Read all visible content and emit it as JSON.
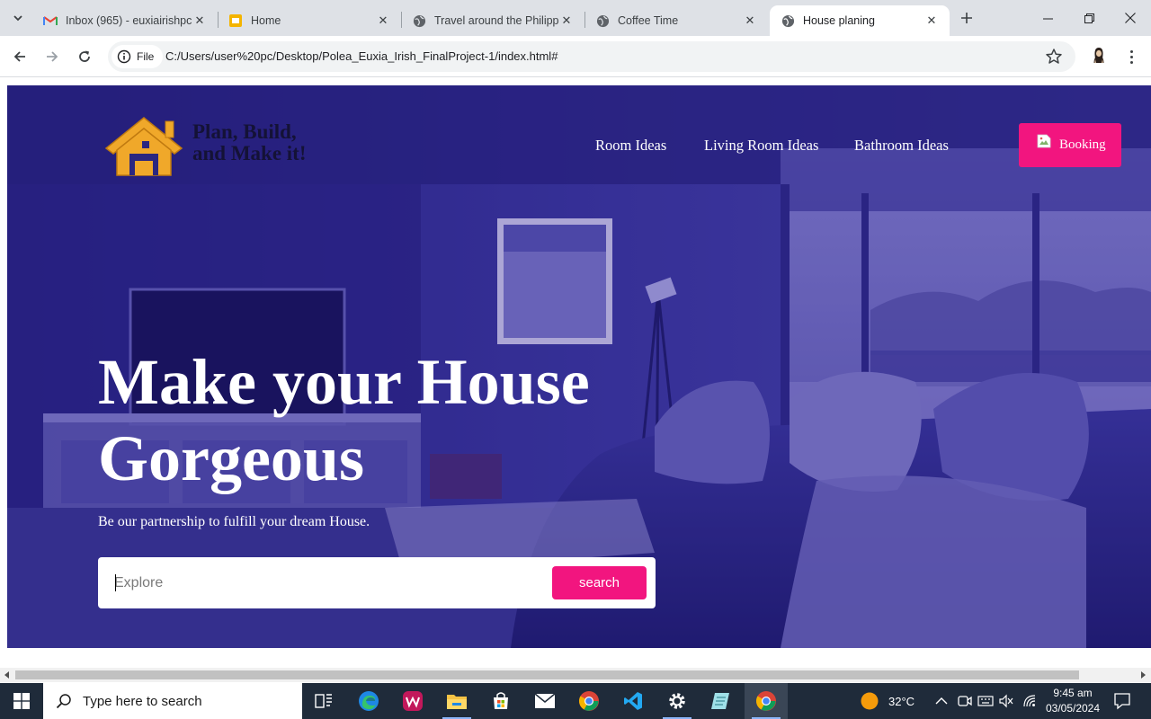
{
  "browser": {
    "tabs": [
      {
        "title": "Inbox (965) - euxiairishpc",
        "favicon": "gmail-icon"
      },
      {
        "title": "Home",
        "favicon": "slides-icon"
      },
      {
        "title": "Travel around the Philippines",
        "favicon": "globe-icon"
      },
      {
        "title": "Coffee Time",
        "favicon": "globe-icon"
      },
      {
        "title": "House planing",
        "favicon": "globe-icon",
        "active": true
      }
    ],
    "site_chip": "File",
    "url": "C:/Users/user%20pc/Desktop/Polea_Euxia_Irish_FinalProject-1/index.html#"
  },
  "page": {
    "brand": {
      "line1": "Plan, Build,",
      "line2": "and Make it!"
    },
    "nav": [
      "Room Ideas",
      "Living Room Ideas",
      "Bathroom Ideas"
    ],
    "booking_label": "Booking",
    "headline": {
      "line1": "Make your House",
      "line2": "Gorgeous"
    },
    "subtitle": "Be our partnership to fulfill your dream House.",
    "search": {
      "placeholder": "Explore",
      "button": "search"
    },
    "colors": {
      "accent": "#f2157f",
      "overlay": "#2a2478",
      "logo": "#f0a82a"
    }
  },
  "taskbar": {
    "search_placeholder": "Type here to search",
    "weather": "32°C",
    "time": "9:45 am",
    "date": "03/05/2024",
    "apps": [
      "task-view-icon",
      "edge-icon",
      "wps-icon",
      "file-explorer-icon",
      "store-icon",
      "mail-icon",
      "chrome-icon",
      "vscode-icon",
      "settings-icon",
      "notepad-icon",
      "chrome-icon"
    ]
  }
}
